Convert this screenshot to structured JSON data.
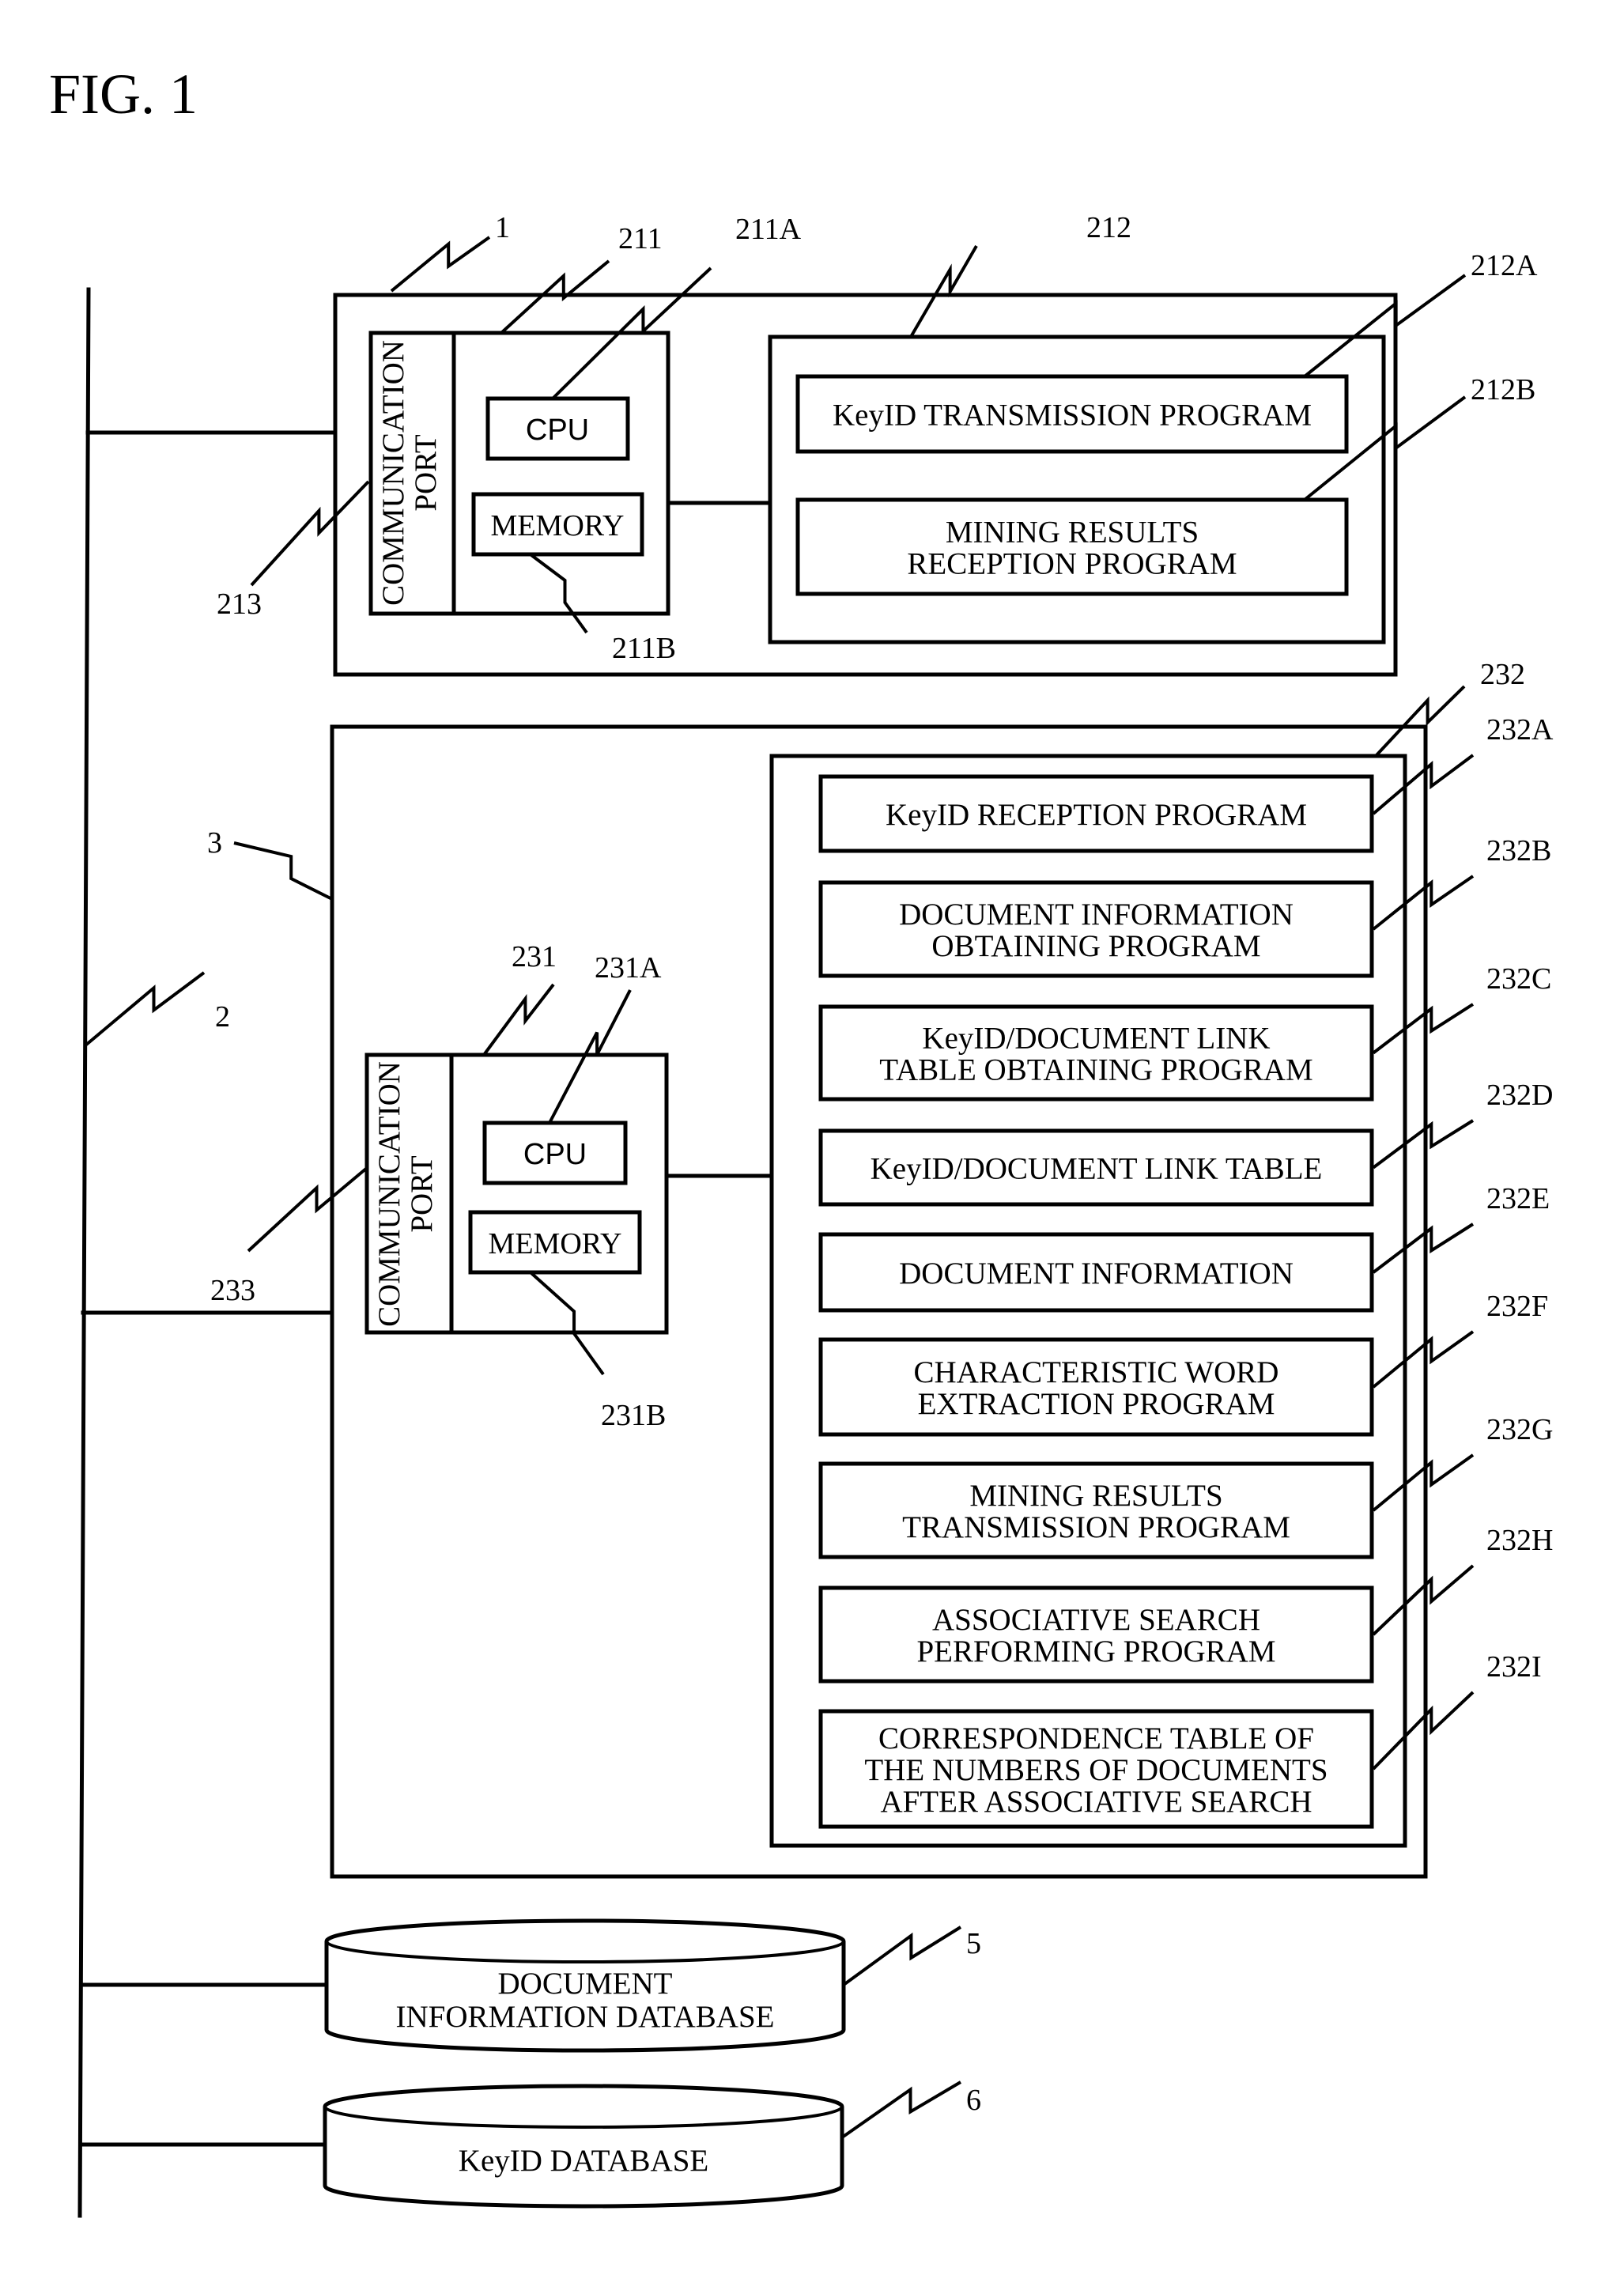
{
  "figure": {
    "title": "FIG. 1"
  },
  "network": {
    "ref": "2"
  },
  "terminal": {
    "ref": "1",
    "processor": {
      "ref": "211",
      "cpu": {
        "ref": "211A",
        "label": "CPU"
      },
      "memory": {
        "ref": "211B",
        "label": "MEMORY"
      }
    },
    "comm_port": {
      "ref": "213",
      "lines": [
        "COMMUNICATION",
        "PORT"
      ]
    },
    "storage": {
      "ref": "212",
      "items": [
        {
          "ref": "212A",
          "lines": [
            "KeyID TRANSMISSION PROGRAM"
          ]
        },
        {
          "ref": "212B",
          "lines": [
            "MINING RESULTS",
            "RECEPTION PROGRAM"
          ]
        }
      ]
    }
  },
  "server": {
    "ref": "3",
    "processor": {
      "ref": "231",
      "cpu": {
        "ref": "231A",
        "label": "CPU"
      },
      "memory": {
        "ref": "231B",
        "label": "MEMORY"
      }
    },
    "comm_port": {
      "ref": "233",
      "lines": [
        "COMMUNICATION",
        "PORT"
      ]
    },
    "storage": {
      "ref": "232",
      "items": [
        {
          "ref": "232A",
          "lines": [
            "KeyID RECEPTION PROGRAM"
          ]
        },
        {
          "ref": "232B",
          "lines": [
            "DOCUMENT INFORMATION",
            "OBTAINING PROGRAM"
          ]
        },
        {
          "ref": "232C",
          "lines": [
            "KeyID/DOCUMENT LINK",
            "TABLE OBTAINING PROGRAM"
          ]
        },
        {
          "ref": "232D",
          "lines": [
            "KeyID/DOCUMENT LINK TABLE"
          ]
        },
        {
          "ref": "232E",
          "lines": [
            "DOCUMENT INFORMATION"
          ]
        },
        {
          "ref": "232F",
          "lines": [
            "CHARACTERISTIC WORD",
            "EXTRACTION PROGRAM"
          ]
        },
        {
          "ref": "232G",
          "lines": [
            "MINING RESULTS",
            "TRANSMISSION PROGRAM"
          ]
        },
        {
          "ref": "232H",
          "lines": [
            "ASSOCIATIVE SEARCH",
            "PERFORMING PROGRAM"
          ]
        },
        {
          "ref": "232I",
          "lines": [
            "CORRESPONDENCE TABLE OF",
            "THE NUMBERS OF DOCUMENTS",
            "AFTER ASSOCIATIVE SEARCH"
          ]
        }
      ]
    }
  },
  "databases": [
    {
      "ref": "5",
      "lines": [
        "DOCUMENT",
        "INFORMATION DATABASE"
      ]
    },
    {
      "ref": "6",
      "lines": [
        "KeyID DATABASE"
      ]
    }
  ]
}
